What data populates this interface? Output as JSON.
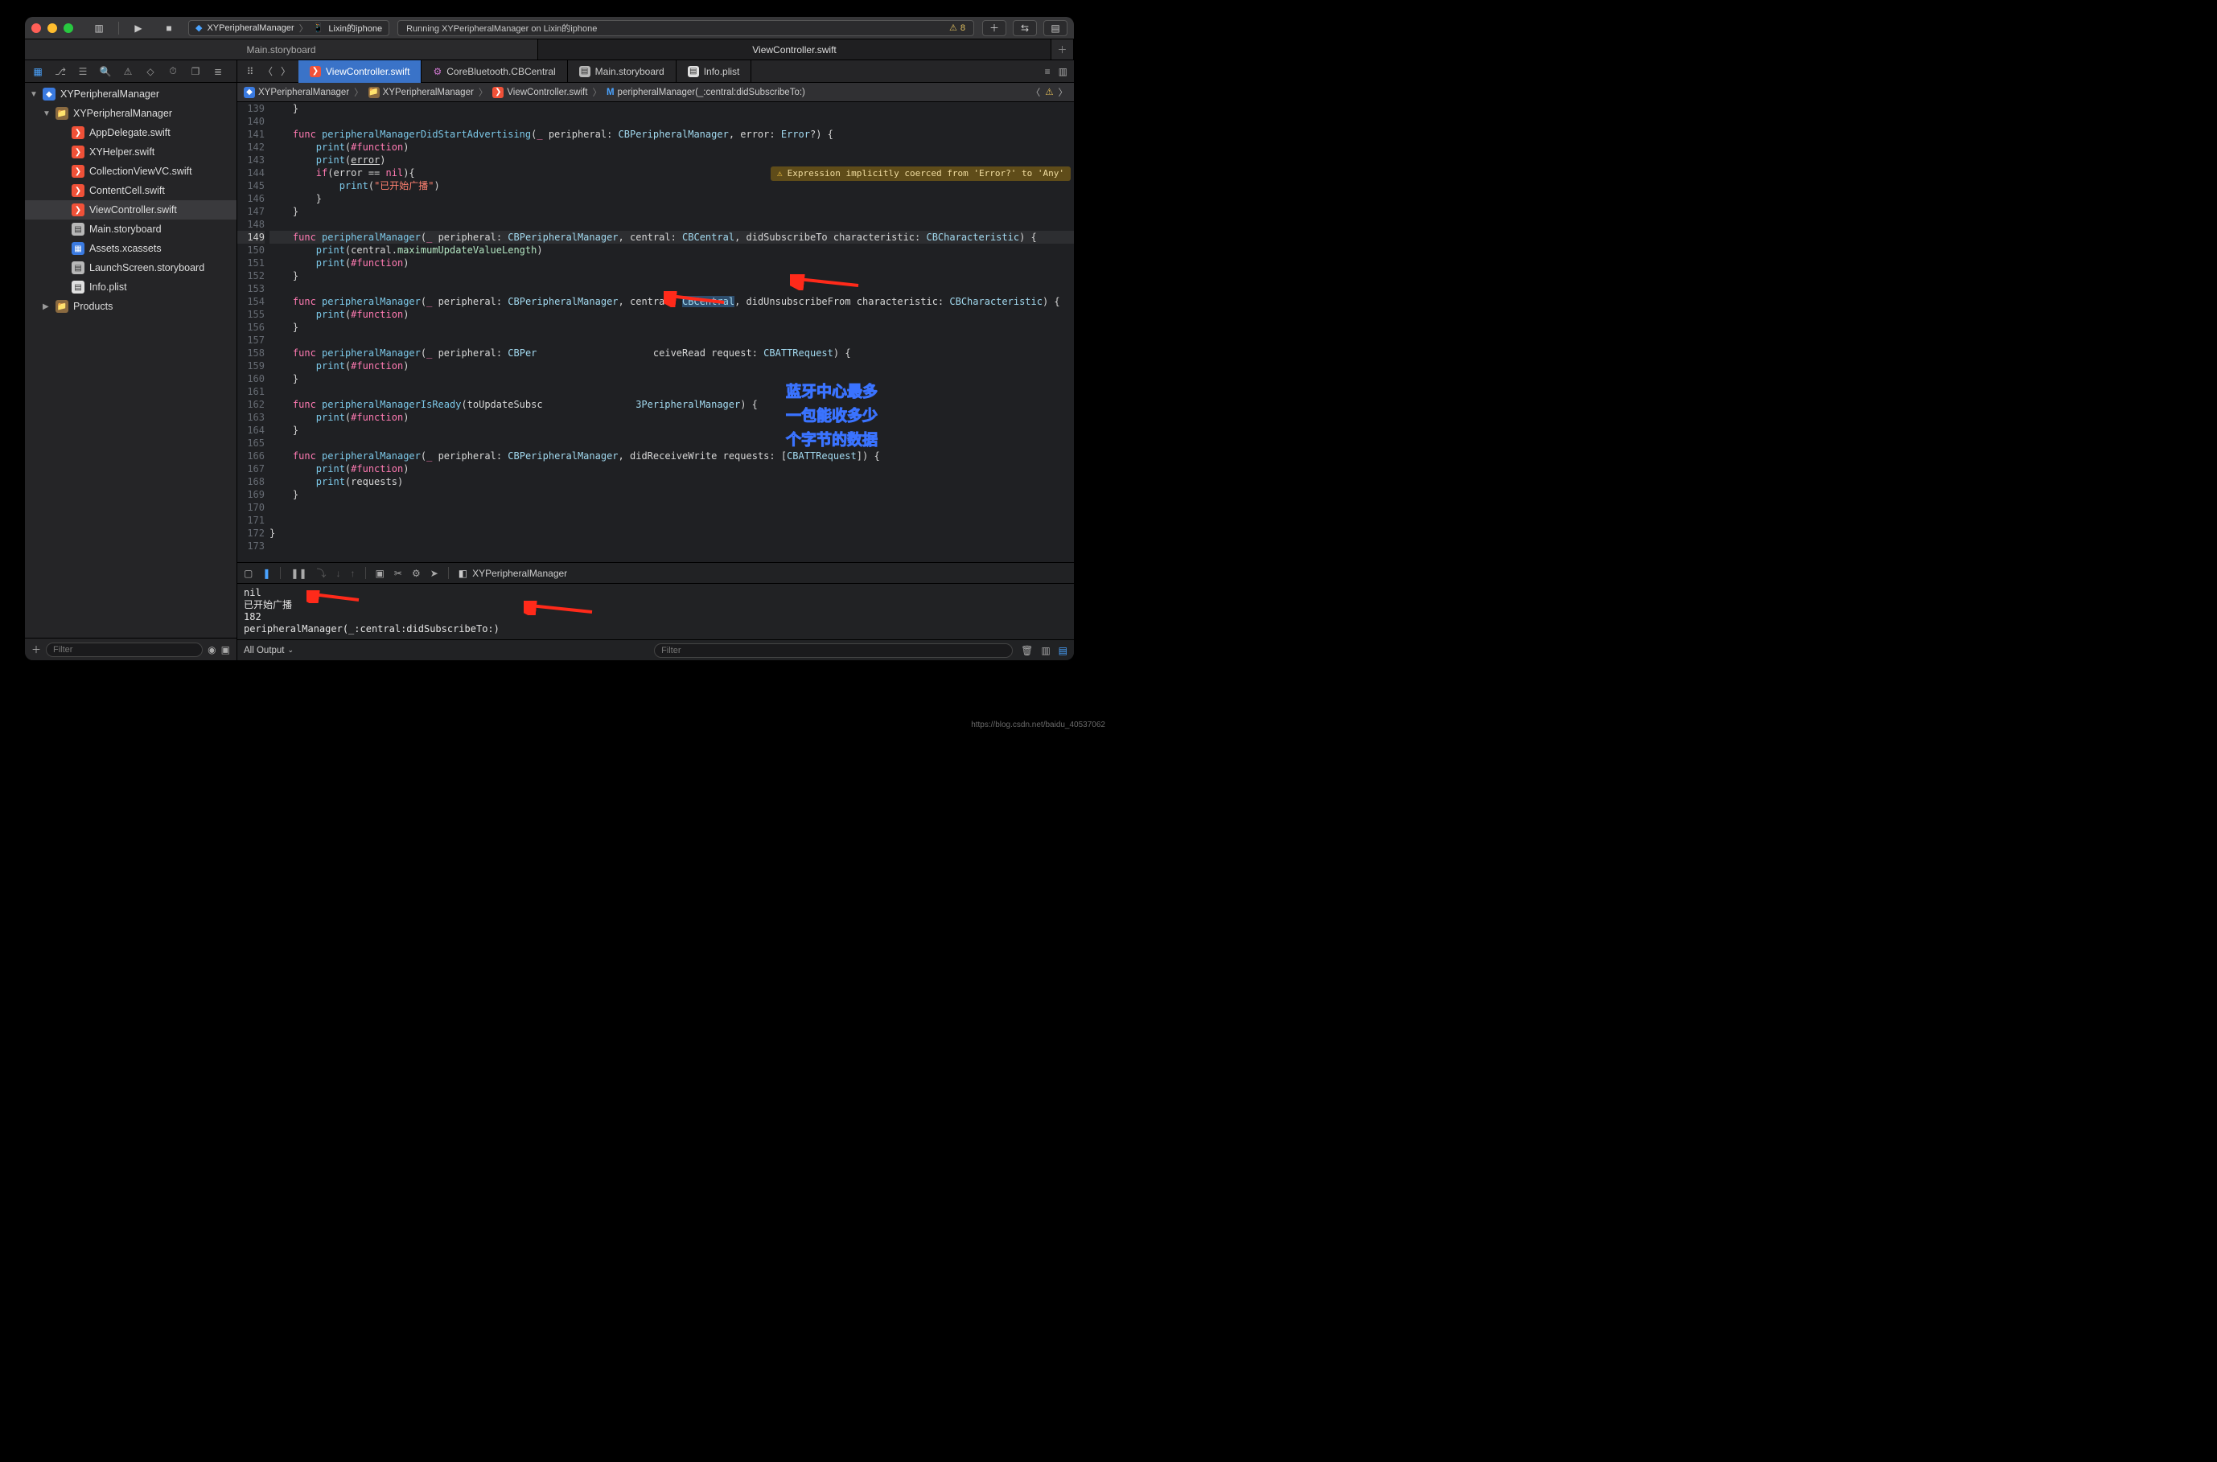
{
  "titlebar": {
    "scheme_project": "XYPeripheralManager",
    "scheme_device": "Lixin的iphone",
    "status": "Running XYPeripheralManager on Lixin的iphone",
    "warning_count": "8"
  },
  "window_tabs": {
    "left": "Main.storyboard",
    "right": "ViewController.swift"
  },
  "navigator": {
    "project": "XYPeripheralManager",
    "group": "XYPeripheralManager",
    "items": [
      "AppDelegate.swift",
      "XYHelper.swift",
      "CollectionViewVC.swift",
      "ContentCell.swift",
      "ViewController.swift",
      "Main.storyboard",
      "Assets.xcassets",
      "LaunchScreen.storyboard",
      "Info.plist"
    ],
    "products": "Products",
    "filter_placeholder": "Filter"
  },
  "editor_tabs": {
    "t0": "ViewController.swift",
    "t1": "CoreBluetooth.CBCentral",
    "t2": "Main.storyboard",
    "t3": "Info.plist"
  },
  "crumb": {
    "c0": "XYPeripheralManager",
    "c1": "XYPeripheralManager",
    "c2": "ViewController.swift",
    "c3": "peripheralManager(_:central:didSubscribeTo:)"
  },
  "inline_warning": "Expression implicitly coerced from 'Error?' to 'Any'",
  "code": {
    "line_start": 139,
    "lines": [
      {
        "n": 139,
        "html": "    <span class='br'>}</span>"
      },
      {
        "n": 140,
        "html": "    "
      },
      {
        "n": 141,
        "html": "    <span class='k'>func</span> <span class='fn'>peripheralManagerDidStartAdvertising</span>(<span class='k'>_</span> peripheral: <span class='t'>CBPeripheralManager</span>, error: <span class='t'>Error</span>?) {"
      },
      {
        "n": 142,
        "html": "        <span class='fn'>print</span>(<span class='kw'>#function</span>)"
      },
      {
        "n": 143,
        "html": "        <span class='fn'>print</span>(<span class='n' style='text-decoration:underline'>error</span>)"
      },
      {
        "n": 144,
        "html": "        <span class='k'>if</span>(error == <span class='k'>nil</span>){"
      },
      {
        "n": 145,
        "html": "            <span class='fn'>print</span>(<span class='s'>\"已开始广播\"</span>)"
      },
      {
        "n": 146,
        "html": "        }"
      },
      {
        "n": 147,
        "html": "    }"
      },
      {
        "n": 148,
        "html": "    "
      },
      {
        "n": 149,
        "hl": true,
        "html": "    <span class='k'>func</span> <span class='fn'>peripheralManager</span>(<span class='k'>_</span> peripheral: <span class='t'>CBPeripheralManager</span>, central: <span class='t'>CBCentral</span>, didSubscribeTo characteristic: <span class='t'>CBCharacteristic</span>) {"
      },
      {
        "n": 150,
        "html": "        <span class='fn'>print</span>(central.<span class='m'>maximumUpdateValueLength</span>)"
      },
      {
        "n": 151,
        "html": "        <span class='fn'>print</span>(<span class='kw'>#function</span>)"
      },
      {
        "n": 152,
        "html": "    }"
      },
      {
        "n": 153,
        "html": "    "
      },
      {
        "n": 154,
        "html": "    <span class='k'>func</span> <span class='fn'>peripheralManager</span>(<span class='k'>_</span> peripheral: <span class='t'>CBPeripheralManager</span>, central: <span class='t' style='background:#2d4d6d'>CBCentral</span>, didUnsubscribeFrom characteristic: <span class='t'>CBCharacteristic</span>) {"
      },
      {
        "n": 155,
        "html": "        <span class='fn'>print</span>(<span class='kw'>#function</span>)"
      },
      {
        "n": 156,
        "html": "    }"
      },
      {
        "n": 157,
        "html": "    "
      },
      {
        "n": 158,
        "html": "    <span class='k'>func</span> <span class='fn'>peripheralManager</span>(<span class='k'>_</span> peripheral: <span class='t'>CBPer</span>                    <span class='n'>ceiveRead request: </span><span class='t'>CBATTRequest</span>) {"
      },
      {
        "n": 159,
        "html": "        <span class='fn'>print</span>(<span class='kw'>#function</span>)"
      },
      {
        "n": 160,
        "html": "    }"
      },
      {
        "n": 161,
        "html": "    "
      },
      {
        "n": 162,
        "html": "    <span class='k'>func</span> <span class='fn'>peripheralManagerIsReady</span>(toUpdateSubsc                <span class='t'>3PeripheralManager</span>) {"
      },
      {
        "n": 163,
        "html": "        <span class='fn'>print</span>(<span class='kw'>#function</span>)"
      },
      {
        "n": 164,
        "html": "    }"
      },
      {
        "n": 165,
        "html": "    "
      },
      {
        "n": 166,
        "html": "    <span class='k'>func</span> <span class='fn'>peripheralManager</span>(<span class='k'>_</span> peripheral: <span class='t'>CBPeripheralManager</span>, didReceiveWrite requests: [<span class='t'>CBATTRequest</span>]) {"
      },
      {
        "n": 167,
        "html": "        <span class='fn'>print</span>(<span class='kw'>#function</span>)"
      },
      {
        "n": 168,
        "html": "        <span class='fn'>print</span>(requests)"
      },
      {
        "n": 169,
        "html": "    }"
      },
      {
        "n": 170,
        "html": "    "
      },
      {
        "n": 171,
        "html": "    "
      },
      {
        "n": 172,
        "html": "}"
      },
      {
        "n": 173,
        "html": ""
      }
    ]
  },
  "annotation": {
    "l1": "蓝牙中心最多",
    "l2": "一包能收多少",
    "l3": "个字节的数据"
  },
  "debug": {
    "target": "XYPeripheralManager",
    "console_lines": [
      "nil",
      "已开始广播",
      "182",
      "peripheralManager(_:central:didSubscribeTo:)"
    ],
    "output_selector": "All Output",
    "filter_placeholder": "Filter"
  },
  "watermark": "https://blog.csdn.net/baidu_40537062"
}
